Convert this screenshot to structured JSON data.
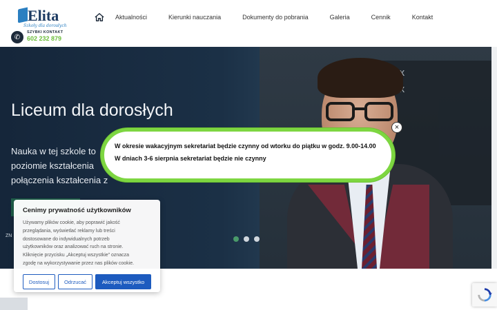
{
  "brand": {
    "name": "Elita",
    "tagline": "Szkoły dla dorosłych",
    "contact_label": "SZYBKI KONTAKT",
    "phone": "602 232 879"
  },
  "nav": {
    "home_icon": "home-icon",
    "items": [
      "Aktualności",
      "Kierunki nauczania",
      "Dokumenty do pobrania",
      "Galeria",
      "Cennik",
      "Kontakt"
    ]
  },
  "hero": {
    "title": "Liceum dla dorosłych",
    "text_lines": [
      "Nauka w tej szkole to",
      "poziomie kształcenia",
      "połączenia kształcenia z"
    ],
    "button_caption": "ZN",
    "slides": 3,
    "active_slide": 2,
    "board_text": "x ≠ 3x\nV = zx\n+ x\n2x =\ny²\nx²"
  },
  "modal": {
    "line1": "W okresie wakacyjnym sekretariat będzie czynny od wtorku do piątku w godz. 9.00-14.00",
    "line2": "W dniach 3-6 sierpnia sekretariat będzie nie czynny",
    "close_label": "×",
    "border_color": "#7dd641"
  },
  "cookie": {
    "title": "Cenimy prywatność użytkowników",
    "body_lines": [
      "Używamy plików cookie, aby poprawić jakość",
      "przeglądania, wyświetlać reklamy lub treści",
      "dostosowane do indywidualnych potrzeb",
      "użytkowników oraz analizować ruch na stronie.",
      "Kliknięcie przycisku „Akceptuj wszystkie” oznacza",
      "zgodę na wykorzystywanie przez nas plików cookie."
    ],
    "buttons": {
      "customize": "Dostosuj",
      "reject": "Odrzucać",
      "accept": "Akceptuj wszystko"
    },
    "accent_color": "#1d5bbf"
  }
}
